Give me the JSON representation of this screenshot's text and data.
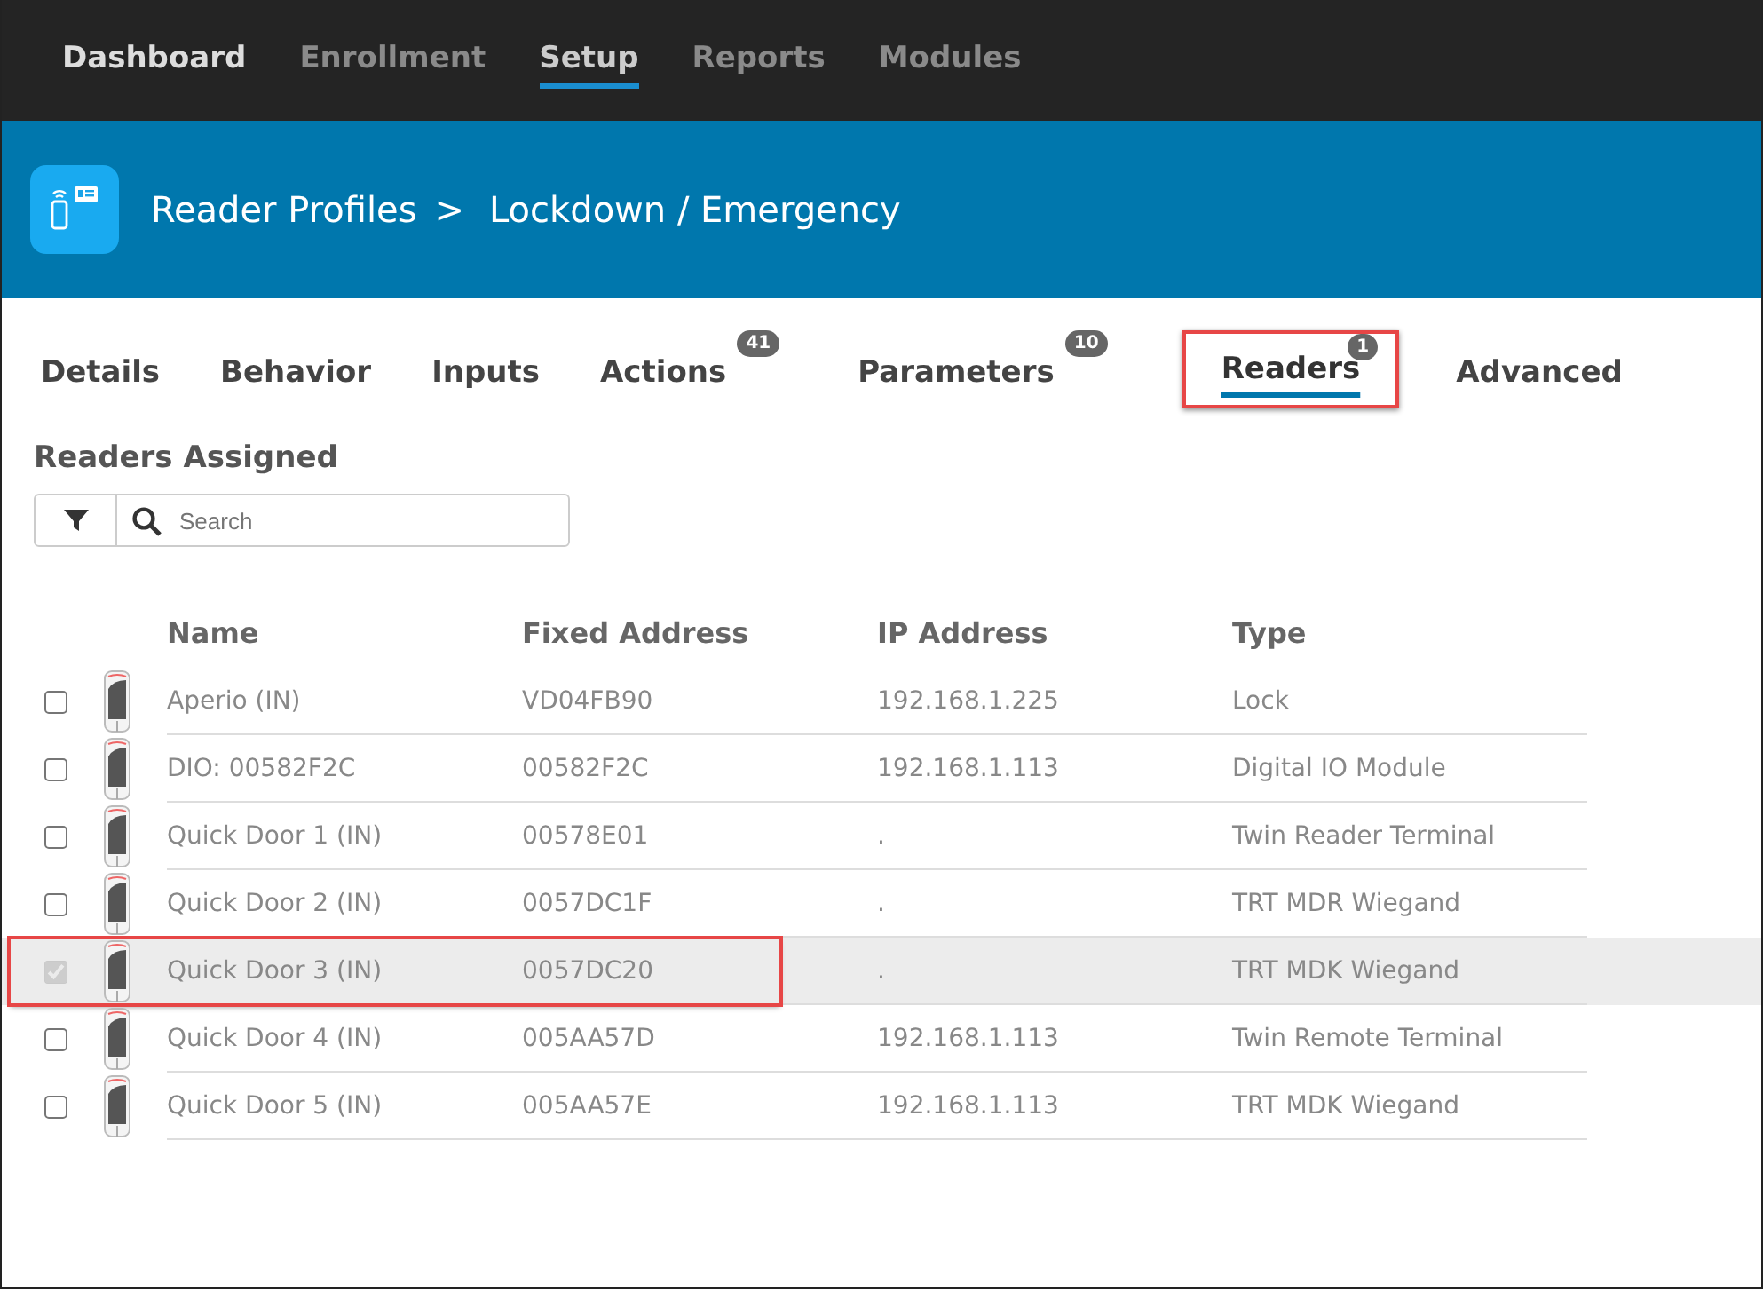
{
  "nav": [
    {
      "label": "Dashboard",
      "selected": false,
      "emphasis": true
    },
    {
      "label": "Enrollment",
      "selected": false,
      "emphasis": false
    },
    {
      "label": "Setup",
      "selected": true,
      "emphasis": false
    },
    {
      "label": "Reports",
      "selected": false,
      "emphasis": false
    },
    {
      "label": "Modules",
      "selected": false,
      "emphasis": false
    }
  ],
  "header": {
    "breadcrumb": "Reader Profiles",
    "separator": ">",
    "title": "Lockdown / Emergency"
  },
  "tabs": [
    {
      "label": "Details",
      "selected": false,
      "highlighted": false
    },
    {
      "label": "Behavior",
      "selected": false,
      "highlighted": false
    },
    {
      "label": "Inputs",
      "selected": false,
      "highlighted": false
    },
    {
      "label": "Actions",
      "count": "41",
      "selected": false,
      "highlighted": false
    },
    {
      "label": "Parameters",
      "count": "10",
      "selected": false,
      "highlighted": false
    },
    {
      "label": "Readers",
      "count": "1",
      "selected": true,
      "highlighted": true
    },
    {
      "label": "Advanced",
      "selected": false,
      "highlighted": false
    }
  ],
  "section_title": "Readers Assigned",
  "search": {
    "placeholder": "Search"
  },
  "table": {
    "columns": [
      "Name",
      "Fixed Address",
      "IP Address",
      "Type"
    ],
    "rows": [
      {
        "cells": [
          "Aperio (IN)",
          "VD04FB90",
          "192.168.1.225",
          "Lock"
        ],
        "checked": false,
        "selected": false,
        "highlighted": false
      },
      {
        "cells": [
          "DIO: 00582F2C",
          "00582F2C",
          "192.168.1.113",
          "Digital IO Module"
        ],
        "checked": false,
        "selected": false,
        "highlighted": false
      },
      {
        "cells": [
          "Quick Door 1 (IN)",
          "00578E01",
          ".",
          "Twin Reader Terminal"
        ],
        "checked": false,
        "selected": false,
        "highlighted": false
      },
      {
        "cells": [
          "Quick Door 2 (IN)",
          "0057DC1F",
          ".",
          "TRT MDR Wiegand"
        ],
        "checked": false,
        "selected": false,
        "highlighted": false
      },
      {
        "cells": [
          "Quick Door 3 (IN)",
          "0057DC20",
          ".",
          "TRT MDK Wiegand"
        ],
        "checked": true,
        "selected": true,
        "highlighted": true
      },
      {
        "cells": [
          "Quick Door 4 (IN)",
          "005AA57D",
          "192.168.1.113",
          "Twin Remote Terminal"
        ],
        "checked": false,
        "selected": false,
        "highlighted": false
      },
      {
        "cells": [
          "Quick Door 5 (IN)",
          "005AA57E",
          "192.168.1.113",
          "TRT MDK Wiegand"
        ],
        "checked": false,
        "selected": false,
        "highlighted": false
      }
    ]
  }
}
